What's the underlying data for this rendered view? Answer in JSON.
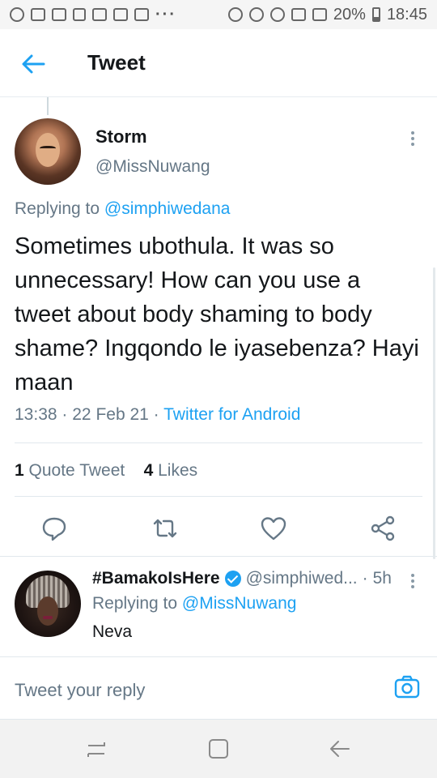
{
  "status_bar": {
    "battery": "20%",
    "time": "18:45",
    "more": "···"
  },
  "header": {
    "title": "Tweet"
  },
  "tweet": {
    "author_name": "Storm",
    "author_handle": "@MissNuwang",
    "replying_prefix": "Replying to",
    "replying_to": "@simphiwedana",
    "text": "Sometimes ubothula. It was so unnecessary! How can you use a tweet about body shaming to body shame? Ingqondo le iyasebenza? Hayi maan",
    "time": "13:38",
    "date": "22 Feb 21",
    "separator": "·",
    "source": "Twitter for Android",
    "quote_count": "1",
    "quote_label": "Quote Tweet",
    "like_count": "4",
    "like_label": "Likes"
  },
  "reply": {
    "author_name": "#BamakoIsHere",
    "author_handle": "@simphiwed...",
    "separator": "·",
    "age": "5h",
    "replying_prefix": "Replying to",
    "replying_to": "@MissNuwang",
    "text": "Neva"
  },
  "composer": {
    "placeholder": "Tweet your reply"
  },
  "colors": {
    "accent": "#1da1f2",
    "text_primary": "#14171a",
    "text_secondary": "#657786"
  },
  "icons": {
    "back": "arrow-left-icon",
    "more": "kebab-icon",
    "reply": "comment-icon",
    "retweet": "retweet-icon",
    "like": "heart-icon",
    "share": "share-icon",
    "verified": "verified-badge-icon",
    "camera": "camera-icon"
  }
}
